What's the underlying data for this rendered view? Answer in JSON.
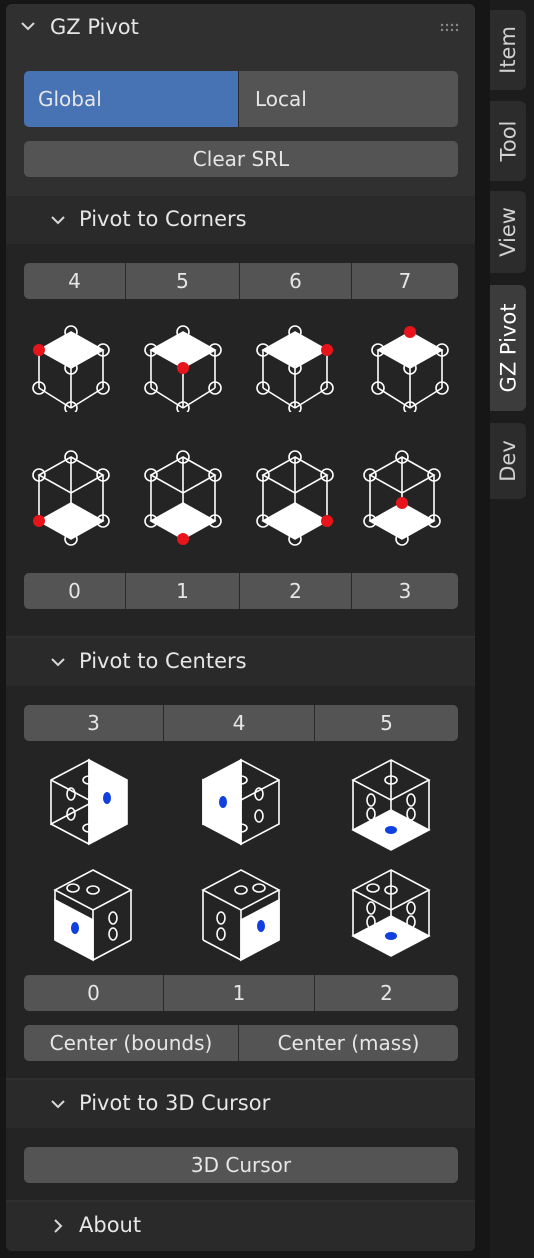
{
  "panel": {
    "title": "GZ Pivot"
  },
  "space": {
    "global_label": "Global",
    "local_label": "Local",
    "global_selected": true
  },
  "clear_srl_label": "Clear SRL",
  "corners": {
    "title": "Pivot to Corners",
    "top_labels": [
      "4",
      "5",
      "6",
      "7"
    ],
    "bottom_labels": [
      "0",
      "1",
      "2",
      "3"
    ]
  },
  "centers": {
    "title": "Pivot to Centers",
    "top_labels": [
      "3",
      "4",
      "5"
    ],
    "bottom_labels": [
      "0",
      "1",
      "2"
    ],
    "center_bounds_label": "Center (bounds)",
    "center_mass_label": "Center (mass)"
  },
  "cursor": {
    "title": "Pivot to 3D Cursor",
    "button_label": "3D Cursor"
  },
  "about": {
    "title": "About"
  },
  "tabs": [
    "Item",
    "Tool",
    "View",
    "GZ Pivot",
    "Dev"
  ],
  "active_tab": "GZ Pivot",
  "colors": {
    "accent": "#4772b3",
    "corner_marker": "#e8141c",
    "center_marker": "#1040e0"
  }
}
